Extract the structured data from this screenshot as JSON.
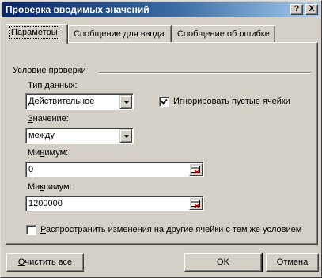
{
  "window": {
    "title": "Проверка вводимых значений",
    "help_glyph": "?",
    "close_glyph": "X"
  },
  "tabs": [
    {
      "label": "Параметры",
      "active": true
    },
    {
      "label": "Сообщение для ввода",
      "active": false
    },
    {
      "label": "Сообщение об ошибке",
      "active": false
    }
  ],
  "group": {
    "label": "Условие проверки"
  },
  "data_type": {
    "label_hotkey": "Т",
    "label_rest": "ип данных:",
    "value": "Действительное"
  },
  "ignore_blanks": {
    "label_hotkey": "И",
    "label_rest": "гнорировать пустые ячейки",
    "checked": true
  },
  "operator": {
    "label_hotkey": "З",
    "label_rest": "начение:",
    "value": "между"
  },
  "minimum": {
    "label_pre": "Ми",
    "label_hotkey": "н",
    "label_rest": "имум:",
    "value": "0"
  },
  "maximum": {
    "label_pre": "Ма",
    "label_hotkey": "к",
    "label_rest": "симум:",
    "value": "1200000"
  },
  "apply_all": {
    "label_hotkey": "Р",
    "label_rest": "аспространить изменения на другие ячейки с тем же условием",
    "checked": false
  },
  "buttons": {
    "clear_hotkey": "О",
    "clear_rest": "чистить все",
    "ok": "OK",
    "cancel": "Отмена"
  },
  "colors": {
    "title_start": "#0a246a",
    "title_end": "#a6caf0",
    "face": "#d4d0c8",
    "ref_red": "#c00000"
  }
}
